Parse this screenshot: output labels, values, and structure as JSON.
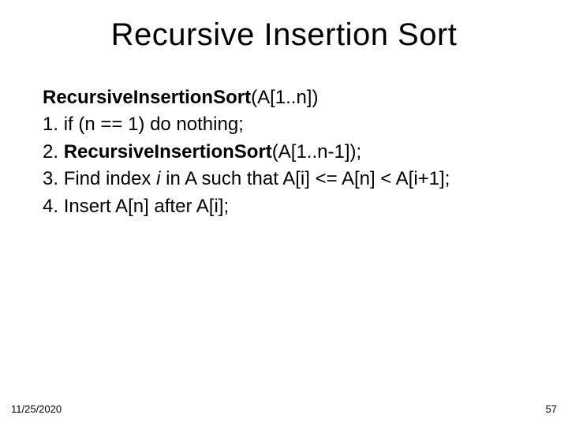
{
  "title": "Recursive Insertion Sort",
  "signature": {
    "func": "RecursiveInsertionSort",
    "args": "(A[1..n])"
  },
  "steps": [
    {
      "num": "1.",
      "text": "if (n == 1) do nothing;"
    },
    {
      "num": "2.",
      "func": "RecursiveInsertionSort",
      "tail": "(A[1..n-1]);"
    },
    {
      "num": "3.",
      "pre": "Find index",
      "var": "i",
      "post": "in A such that A[i] <= A[n] < A[i+1];"
    },
    {
      "num": "4.",
      "text": "Insert A[n] after A[i];"
    }
  ],
  "footer": {
    "date": "11/25/2020",
    "page": "57"
  }
}
